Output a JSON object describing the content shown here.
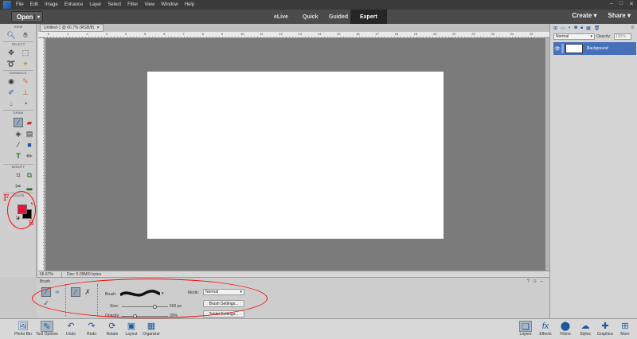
{
  "menu": {
    "items": [
      "File",
      "Edit",
      "Image",
      "Enhance",
      "Layer",
      "Select",
      "Filter",
      "View",
      "Window",
      "Help"
    ]
  },
  "modebar": {
    "open_label": "Open",
    "tabs": [
      "eLive",
      "Quick",
      "Guided",
      "Expert"
    ],
    "active_tab": "Expert",
    "create_label": "Create",
    "share_label": "Share"
  },
  "toolbox": {
    "sections": [
      "VIEW",
      "SELECT",
      "ENHANCE",
      "DRAW",
      "MODIFY",
      "COLOR"
    ],
    "foreground_color": "#e0143c",
    "background_color": "#000000"
  },
  "document": {
    "tab_title": "Untitled-1 @ 66.7% (RGB/8)",
    "ruler_ticks": [
      "0",
      "1",
      "2",
      "3",
      "4",
      "5",
      "6",
      "7",
      "8",
      "9",
      "10",
      "11",
      "12",
      "13",
      "14",
      "15",
      "16",
      "17",
      "18",
      "19",
      "20",
      "21",
      "22",
      "23",
      "24",
      "25"
    ],
    "zoom": "66.67%",
    "doc_info": "Doc: 5.09M/0 bytes"
  },
  "layers": {
    "blend_mode": "Normal",
    "opacity_label": "Opacity:",
    "opacity_value": "100%",
    "layer_name": "Background"
  },
  "tool_options": {
    "title": "Brush",
    "brush_label": "Brush:",
    "size_label": "Size:",
    "size_value": "500 px",
    "size_fraction": 0.72,
    "opacity_label": "Opacity:",
    "opacity_value": "30%",
    "opacity_fraction": 0.3,
    "mode_label": "Mode:",
    "mode_value": "Normal",
    "brush_settings_label": "Brush Settings...",
    "tablet_settings_label": "Tablet Settings..."
  },
  "annotations": {
    "f_label": "F",
    "b_label": "B"
  },
  "taskbar": {
    "left": [
      "Photo Bin",
      "Tool Options",
      "Undo",
      "Redo",
      "Rotate",
      "Layout",
      "Organizer"
    ],
    "right": [
      "Layers",
      "Effects",
      "Filters",
      "Styles",
      "Graphics",
      "More"
    ]
  }
}
